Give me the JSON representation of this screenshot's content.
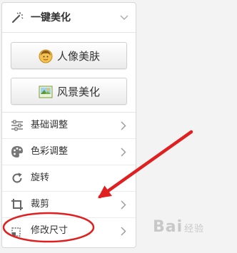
{
  "panel": {
    "header": {
      "title": "一键美化",
      "icon": "magic-wand-icon"
    },
    "buttons": [
      {
        "label": "人像美肤",
        "icon": "portrait-face-icon"
      },
      {
        "label": "风景美化",
        "icon": "landscape-picture-icon"
      }
    ],
    "menu": [
      {
        "label": "基础调整",
        "icon": "sliders-icon"
      },
      {
        "label": "色彩调整",
        "icon": "palette-icon"
      },
      {
        "label": "旋转",
        "icon": "rotate-icon"
      },
      {
        "label": "裁剪",
        "icon": "crop-icon"
      },
      {
        "label": "修改尺寸",
        "icon": "resize-icon"
      }
    ]
  },
  "watermark": {
    "text": "Bai",
    "suffix": "经验"
  },
  "colors": {
    "annotation_red": "#e02020",
    "panel_bg": "#ffffff",
    "page_bg": "#f3f3f3"
  }
}
